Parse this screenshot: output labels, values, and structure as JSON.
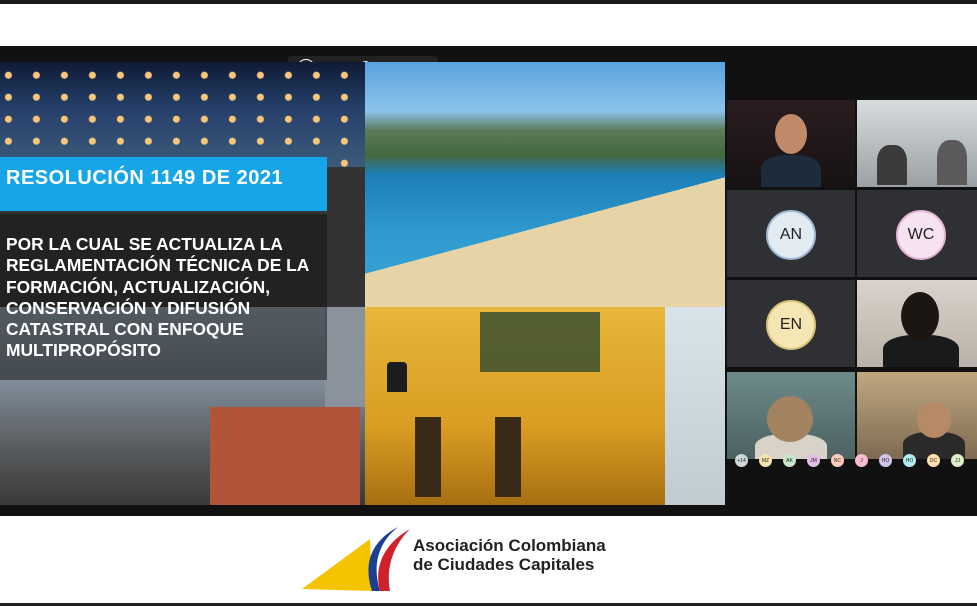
{
  "toolbar": {
    "brand": "hp",
    "icons": [
      "hp-logo-icon",
      "speaker-icon",
      "microphone-icon",
      "broadcast-icon",
      "code-icon"
    ]
  },
  "slide": {
    "title": "RESOLUCIÓN  1149 DE 2021",
    "description_lines": [
      "POR LA CUAL SE ACTUALIZA LA",
      "REGLAMENTACIÓN TÉCNICA DE LA",
      "FORMACIÓN, ACTUALIZACIÓN,",
      "CONSERVACIÓN Y DIFUSIÓN",
      "CATASTRAL CON ENFOQUE",
      "MULTIPROPÓSITO"
    ]
  },
  "participants": {
    "avatars": [
      "AN",
      "WC",
      "EN"
    ],
    "mini_avatars": [
      "+14",
      "MZ",
      "AK",
      "JM",
      "NC",
      "J",
      "HO",
      "HO",
      "DC",
      "JJ"
    ]
  },
  "footer": {
    "org_line1": "Asociación Colombiana",
    "org_line2": "de Ciudades Capitales"
  },
  "colors": {
    "accent": "#16a6e8",
    "flag_yellow": "#f5c400",
    "flag_blue": "#1c3f94",
    "flag_red": "#d0202c"
  }
}
